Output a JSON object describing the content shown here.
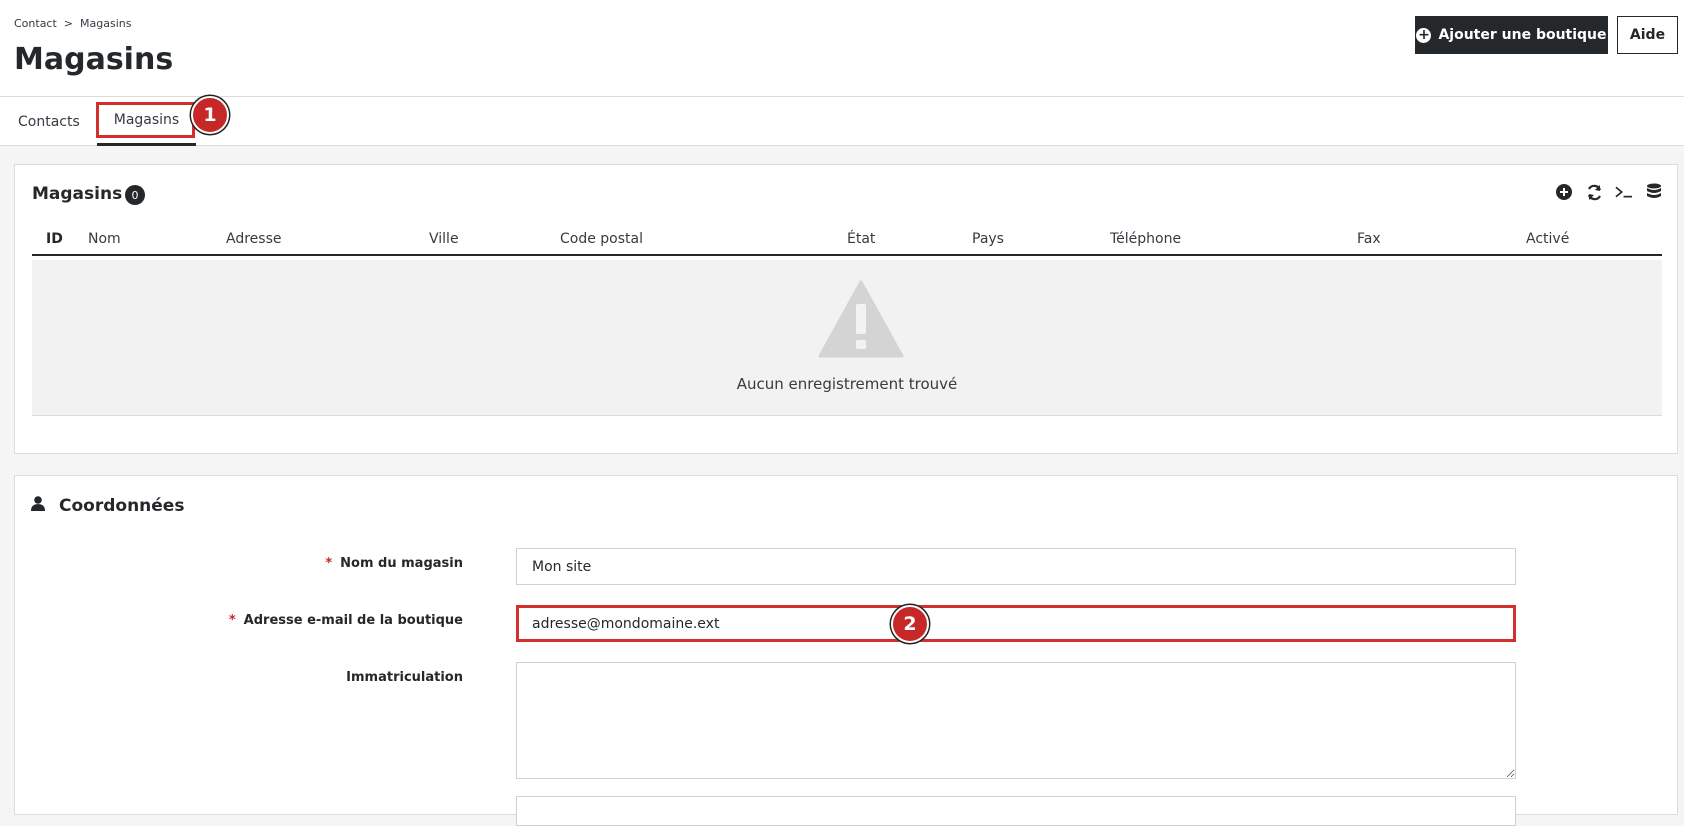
{
  "breadcrumb": {
    "items": [
      "Contact",
      "Magasins"
    ],
    "separator": ">"
  },
  "page": {
    "title": "Magasins"
  },
  "toolbar": {
    "add_label": "Ajouter une boutique",
    "help_label": "Aide"
  },
  "tabs": [
    {
      "label": "Contacts"
    },
    {
      "label": "Magasins",
      "active": true
    }
  ],
  "callouts": {
    "one": "1",
    "two": "2"
  },
  "list": {
    "title": "Magasins",
    "count": "0",
    "columns": [
      "ID",
      "Nom",
      "Adresse",
      "Ville",
      "Code postal",
      "État",
      "Pays",
      "Téléphone",
      "Fax",
      "Activé"
    ],
    "empty_text": "Aucun enregistrement trouvé",
    "tool_icons": [
      "plus-circle-icon",
      "refresh-icon",
      "terminal-icon",
      "database-icon"
    ]
  },
  "form": {
    "title": "Coordonnées",
    "fields": {
      "shop_name": {
        "label": "Nom du magasin",
        "value": "Mon site",
        "required": true
      },
      "shop_email": {
        "label": "Adresse e-mail de la boutique",
        "value": "adresse@mondomaine.ext",
        "required": true
      },
      "registration": {
        "label": "Immatriculation",
        "value": ""
      }
    },
    "required_marker": "*"
  },
  "colors": {
    "accent_dark": "#25282b",
    "highlight": "#d32f2f",
    "required": "#c62828"
  }
}
